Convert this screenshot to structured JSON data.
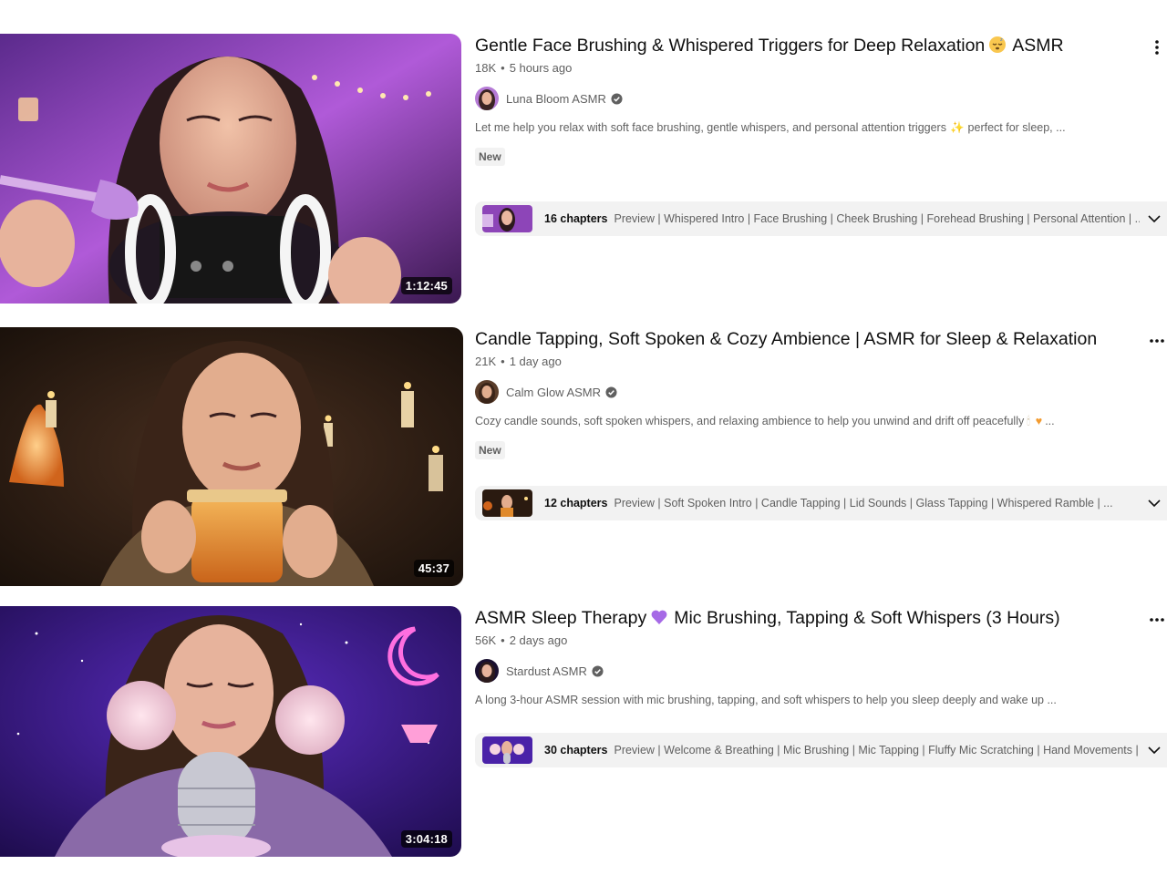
{
  "videos": [
    {
      "title_a": "Gentle Face Brushing & Whispered Triggers for Deep Relaxation",
      "title_b": "ASMR",
      "title_emoji": "sleeping-face-emoji",
      "views": "18K",
      "age": "5 hours ago",
      "channel": "Luna Bloom ASMR",
      "description_a": "Let me help you relax with soft face brushing, gentle whispers, and personal attention triggers",
      "description_b": "perfect for sleep, ...",
      "badge": "New",
      "duration": "1:12:45",
      "chapters_count": "16 chapters",
      "chapters_list": "Preview | Whispered Intro | Face Brushing | Cheek Brushing | Forehead Brushing | Personal Attention | ..."
    },
    {
      "title_a": "Candle Tapping, Soft Spoken & Cozy Ambience | ASMR for Sleep & Relaxation",
      "views": "21K",
      "age": "1 day ago",
      "channel": "Calm Glow ASMR",
      "description_a": "Cozy candle sounds, soft spoken whispers, and relaxing ambience to help you unwind and drift off peacefully",
      "description_b": "...",
      "badge": "New",
      "duration": "45:37",
      "chapters_count": "12 chapters",
      "chapters_list": "Preview | Soft Spoken Intro | Candle Tapping | Lid Sounds | Glass Tapping | Whispered Ramble | ..."
    },
    {
      "title_a": "ASMR Sleep Therapy",
      "title_b": "Mic Brushing, Tapping & Soft Whispers (3 Hours)",
      "title_emoji": "purple-heart-emoji",
      "views": "56K",
      "age": "2 days ago",
      "channel": "Stardust ASMR",
      "description_a": "A long 3-hour ASMR session with mic brushing, tapping, and soft whispers to help you sleep deeply and wake up ...",
      "duration": "3:04:18",
      "chapters_count": "30 chapters",
      "chapters_list": "Preview | Welcome & Breathing | Mic Brushing | Mic Tapping | Fluffy Mic Scratching | Hand Movements | ..."
    }
  ],
  "meta_separator": "•",
  "colors": {
    "text_primary": "#0f0f0f",
    "text_secondary": "#606060",
    "chip_bg": "#f2f2f2",
    "thumb1_accent": "#a24bd6",
    "thumb2_accent": "#e08a2c",
    "thumb3_accent": "#6b2bd9"
  }
}
